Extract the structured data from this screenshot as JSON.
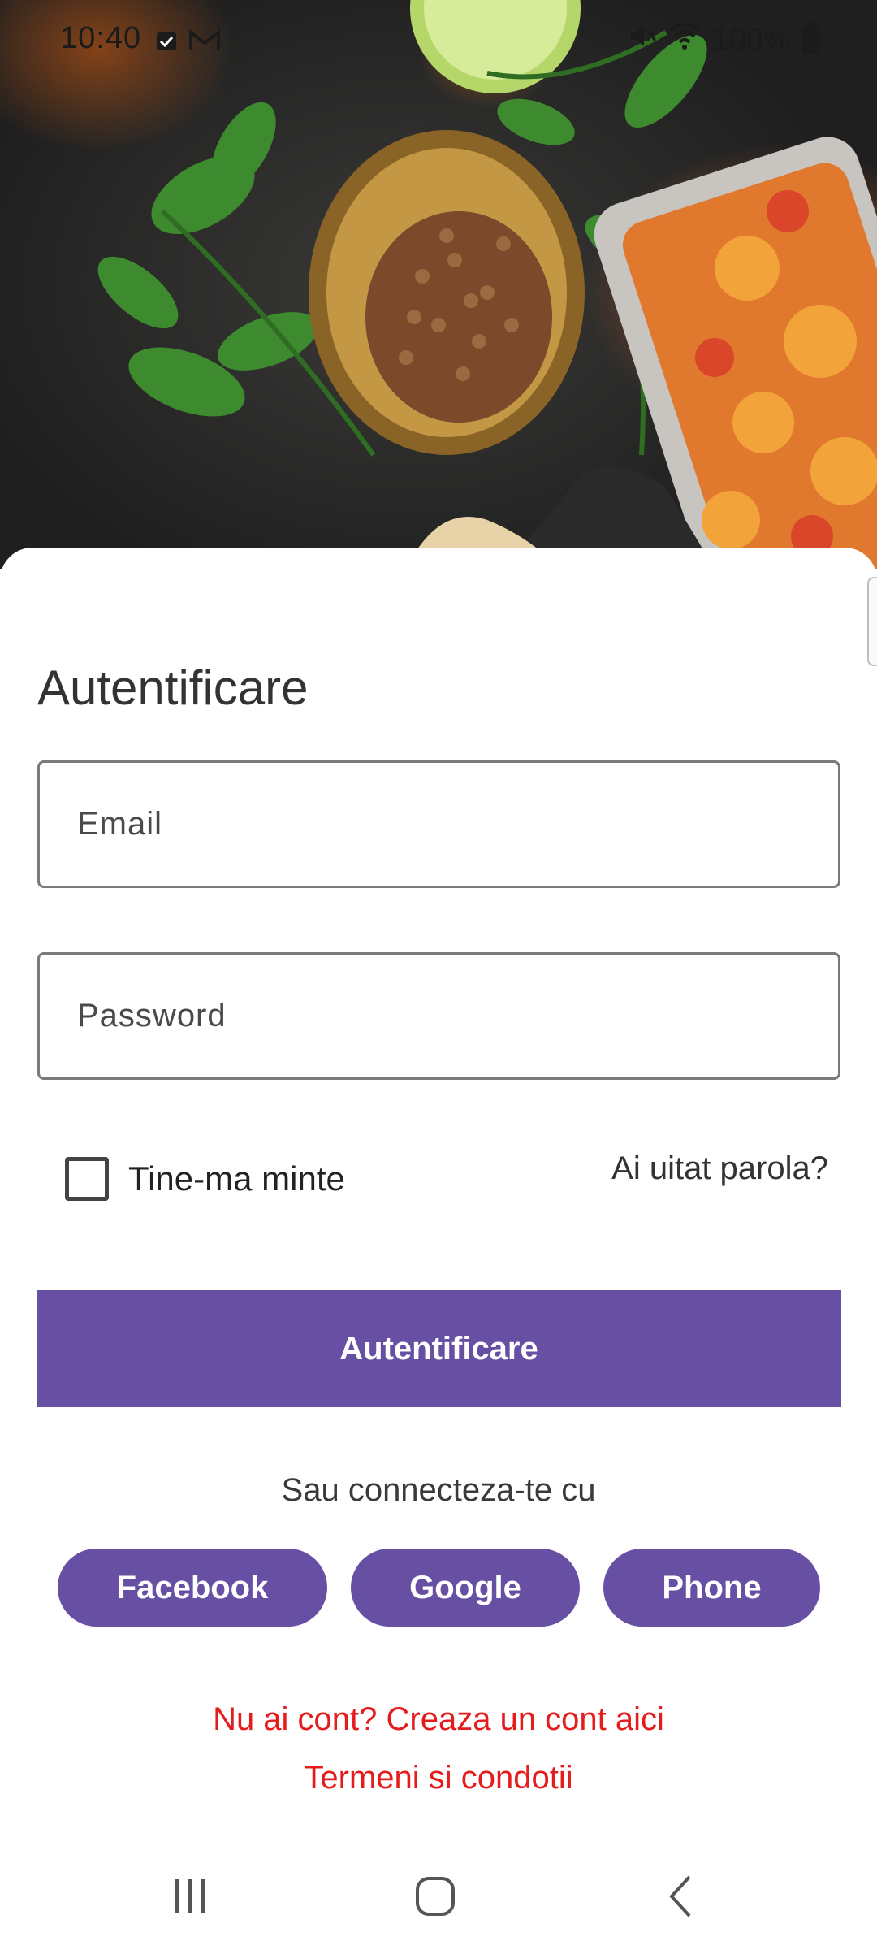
{
  "status_bar": {
    "time": "10:40",
    "battery": "100%",
    "icons": [
      "calendar-notification-icon",
      "gmail-icon",
      "mute-icon",
      "wifi-icon",
      "battery-icon"
    ]
  },
  "hero": {
    "image": "food-spices-background"
  },
  "login": {
    "title": "Autentificare",
    "email_placeholder": "Email",
    "password_placeholder": "Password",
    "remember_label": "Tine-ma minte",
    "remember_checked": false,
    "forgot_label": "Ai uitat parola?",
    "submit_label": "Autentificare"
  },
  "social": {
    "prompt": "Sau connecteza-te cu",
    "buttons": [
      "Facebook",
      "Google",
      "Phone"
    ]
  },
  "links": {
    "signup": "Nu ai cont? Creaza un cont aici",
    "terms": "Termeni si condotii"
  },
  "colors": {
    "accent": "#6750a4",
    "link_red": "#e51c1c",
    "text": "#333333"
  },
  "navigation_bar": {
    "buttons": [
      "recents-icon",
      "home-icon",
      "back-icon"
    ]
  }
}
